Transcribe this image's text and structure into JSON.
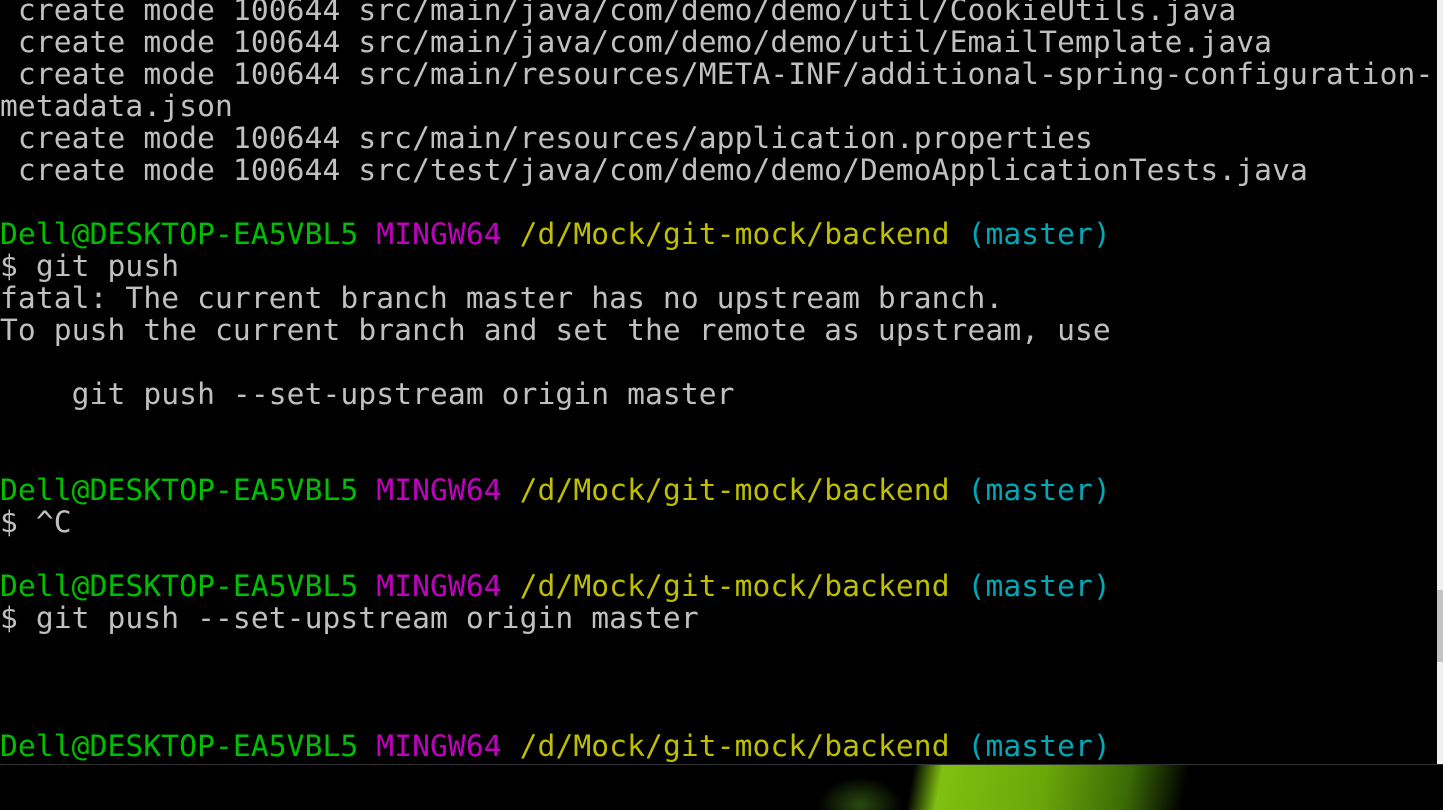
{
  "colors": {
    "default": "#c0c0c0",
    "green": "#00bf00",
    "magenta": "#bf00bf",
    "yellow": "#bfbf00",
    "cyan": "#00a8b8"
  },
  "terminal": {
    "lines": [
      [
        {
          "t": " create mode 100644 src/main/java/com/demo/demo/util/CookieUtils.java",
          "c": "default"
        }
      ],
      [
        {
          "t": " create mode 100644 src/main/java/com/demo/demo/util/EmailTemplate.java",
          "c": "default"
        }
      ],
      [
        {
          "t": " create mode 100644 src/main/resources/META-INF/additional-spring-configuration-",
          "c": "default"
        }
      ],
      [
        {
          "t": "metadata.json",
          "c": "default"
        }
      ],
      [
        {
          "t": " create mode 100644 src/main/resources/application.properties",
          "c": "default"
        }
      ],
      [
        {
          "t": " create mode 100644 src/test/java/com/demo/demo/DemoApplicationTests.java",
          "c": "default"
        }
      ],
      [],
      [
        {
          "t": "Dell@DESKTOP-EA5VBL5 ",
          "c": "green"
        },
        {
          "t": "MINGW64 ",
          "c": "magenta"
        },
        {
          "t": "/d/Mock/git-mock/backend ",
          "c": "yellow"
        },
        {
          "t": "(master)",
          "c": "cyan"
        }
      ],
      [
        {
          "t": "$ git push",
          "c": "default"
        }
      ],
      [
        {
          "t": "fatal: The current branch master has no upstream branch.",
          "c": "default"
        }
      ],
      [
        {
          "t": "To push the current branch and set the remote as upstream, use",
          "c": "default"
        }
      ],
      [],
      [
        {
          "t": "    git push --set-upstream origin master",
          "c": "default"
        }
      ],
      [],
      [],
      [
        {
          "t": "Dell@DESKTOP-EA5VBL5 ",
          "c": "green"
        },
        {
          "t": "MINGW64 ",
          "c": "magenta"
        },
        {
          "t": "/d/Mock/git-mock/backend ",
          "c": "yellow"
        },
        {
          "t": "(master)",
          "c": "cyan"
        }
      ],
      [
        {
          "t": "$ ^C",
          "c": "default"
        }
      ],
      [],
      [
        {
          "t": "Dell@DESKTOP-EA5VBL5 ",
          "c": "green"
        },
        {
          "t": "MINGW64 ",
          "c": "magenta"
        },
        {
          "t": "/d/Mock/git-mock/backend ",
          "c": "yellow"
        },
        {
          "t": "(master)",
          "c": "cyan"
        }
      ],
      [
        {
          "t": "$ git push --set-upstream origin master",
          "c": "default"
        }
      ],
      [],
      [],
      [],
      [
        {
          "t": "Dell@DESKTOP-EA5VBL5 ",
          "c": "green"
        },
        {
          "t": "MINGW64 ",
          "c": "magenta"
        },
        {
          "t": "/d/Mock/git-mock/backend ",
          "c": "yellow"
        },
        {
          "t": "(master)",
          "c": "cyan"
        }
      ]
    ]
  }
}
